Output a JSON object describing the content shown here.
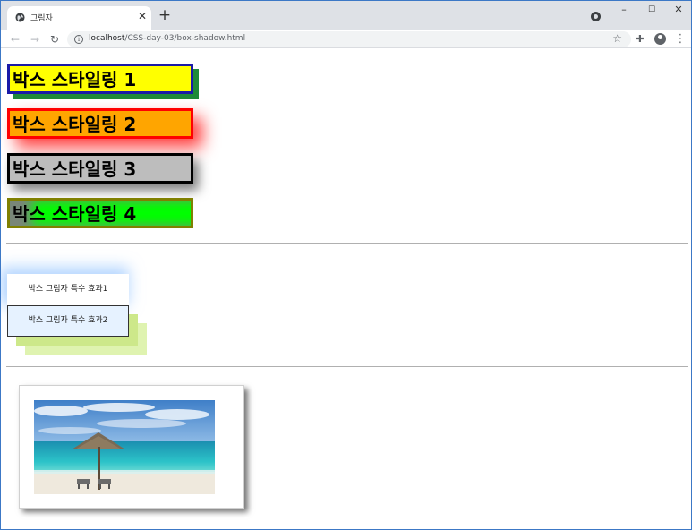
{
  "browser": {
    "tab_title": "그림자",
    "url_host": "localhost",
    "url_path": "/CSS-day-03/box-shadow.html"
  },
  "styled_boxes": [
    {
      "label": "박스 스타일링 1"
    },
    {
      "label": "박스 스타일링 2"
    },
    {
      "label": "박스 스타일링 3"
    },
    {
      "label": "박스 스타일링 4"
    }
  ],
  "effect_boxes": [
    {
      "label": "박스 그림자 특수 효과1"
    },
    {
      "label": "박스 그림자 특수 효과2"
    }
  ],
  "icons": {
    "favicon": "globe-icon",
    "close": "close-icon",
    "new_tab": "plus-icon",
    "back": "arrow-left-icon",
    "forward": "arrow-right-icon",
    "reload": "reload-icon",
    "site_info": "info-icon",
    "bookmark": "star-icon",
    "extensions": "puzzle-icon",
    "profile": "avatar-icon",
    "menu": "kebab-menu-icon"
  },
  "colors": {
    "box1_bg": "#ffff00",
    "box2_bg": "#ffa500",
    "box3_bg": "#bdbdbd",
    "box4_bg": "#00ff00"
  }
}
